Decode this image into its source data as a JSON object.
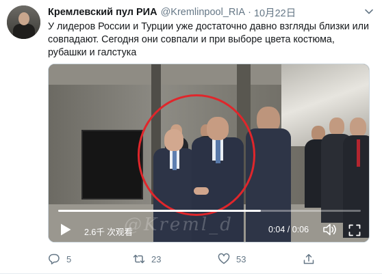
{
  "tweet": {
    "display_name": "Кремлевский пул РИА",
    "handle": "@Kremlinpool_RIA",
    "separator": "·",
    "date": "10月22日",
    "text": "У лидеров России и Турции уже достаточно давно взгляды близки или совпадают. Сегодня они совпали и при выборе цвета костюма, рубашки и галстука"
  },
  "video": {
    "views": "2.6千 次观看",
    "time": "0:04 / 0:06",
    "progress_fraction": 0.67,
    "watermark": "@Kreml_d",
    "highlight_color": "#e0262b"
  },
  "actions": {
    "reply_count": "5",
    "retweet_count": "23",
    "like_count": "53"
  },
  "icons": [
    "chevron-down-icon",
    "play-icon",
    "volume-icon",
    "fullscreen-icon",
    "reply-icon",
    "retweet-icon",
    "like-icon",
    "share-icon"
  ],
  "colors": {
    "text": "#14171a",
    "muted": "#657786",
    "border": "#e6ecf0"
  }
}
